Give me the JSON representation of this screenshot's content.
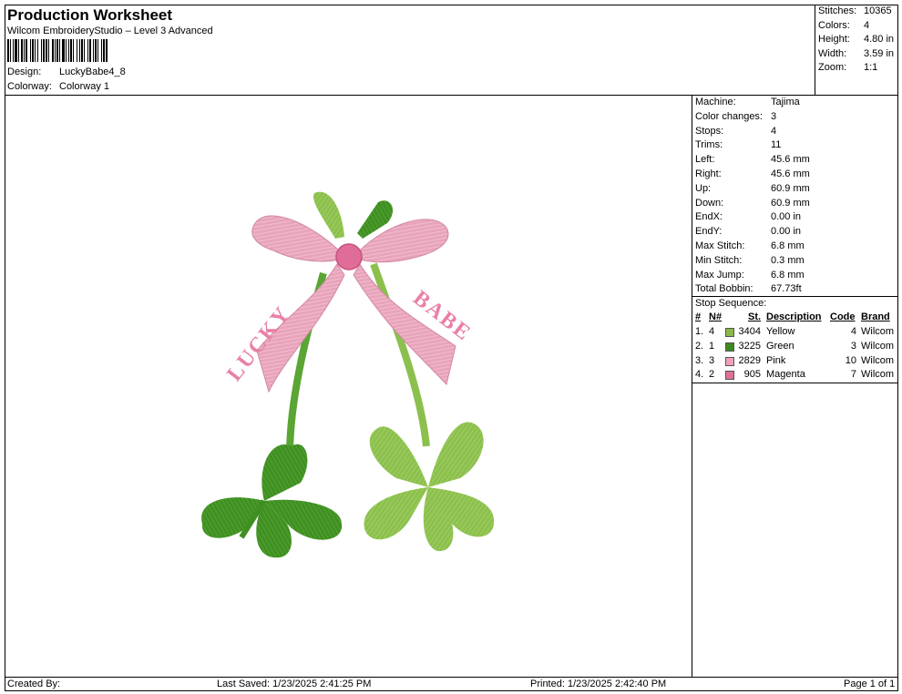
{
  "header": {
    "title": "Production Worksheet",
    "subtitle": "Wilcom EmbroideryStudio – Level 3 Advanced",
    "design_label": "Design:",
    "design_value": "LuckyBabe4_8",
    "colorway_label": "Colorway:",
    "colorway_value": "Colorway 1"
  },
  "stats": [
    {
      "label": "Stitches:",
      "value": "10365"
    },
    {
      "label": "Colors:",
      "value": "4"
    },
    {
      "label": "Height:",
      "value": "4.80 in"
    },
    {
      "label": "Width:",
      "value": "3.59 in"
    },
    {
      "label": "Zoom:",
      "value": "1:1"
    }
  ],
  "machine_info": [
    {
      "label": "Machine:",
      "value": "Tajima"
    },
    {
      "label": "Color changes:",
      "value": "3"
    },
    {
      "label": "Stops:",
      "value": "4"
    },
    {
      "label": "Trims:",
      "value": "11"
    },
    {
      "label": "Left:",
      "value": "45.6 mm"
    },
    {
      "label": "Right:",
      "value": "45.6 mm"
    },
    {
      "label": "Up:",
      "value": "60.9 mm"
    },
    {
      "label": "Down:",
      "value": "60.9 mm"
    },
    {
      "label": "EndX:",
      "value": "0.00 in"
    },
    {
      "label": "EndY:",
      "value": "0.00 in"
    },
    {
      "label": "Max Stitch:",
      "value": "6.8 mm"
    },
    {
      "label": "Min Stitch:",
      "value": "0.3 mm"
    },
    {
      "label": "Max Jump:",
      "value": "6.8 mm"
    },
    {
      "label": "Total Bobbin:",
      "value": "67.73ft"
    }
  ],
  "stop_sequence": {
    "title": "Stop Sequence:",
    "headers": {
      "num": "#",
      "n": "N#",
      "st": "St.",
      "description": "Description",
      "code": "Code",
      "brand": "Brand"
    },
    "rows": [
      {
        "num": "1.",
        "n": "4",
        "color": "#8ab84a",
        "st": "3404",
        "description": "Yellow",
        "code": "4",
        "brand": "Wilcom"
      },
      {
        "num": "2.",
        "n": "1",
        "color": "#3d8a1e",
        "st": "3225",
        "description": "Green",
        "code": "3",
        "brand": "Wilcom"
      },
      {
        "num": "3.",
        "n": "3",
        "color": "#f0a0b8",
        "st": "2829",
        "description": "Pink",
        "code": "10",
        "brand": "Wilcom"
      },
      {
        "num": "4.",
        "n": "2",
        "color": "#e0709a",
        "st": "905",
        "description": "Magenta",
        "code": "7",
        "brand": "Wilcom"
      }
    ]
  },
  "design_text": {
    "left": "LUCKY",
    "right": "BABE"
  },
  "footer": {
    "created_by": "Created By:",
    "last_saved": "Last Saved: 1/23/2025 2:41:25 PM",
    "printed": "Printed: 1/23/2025 2:42:40 PM",
    "page": "Page 1 of 1"
  }
}
